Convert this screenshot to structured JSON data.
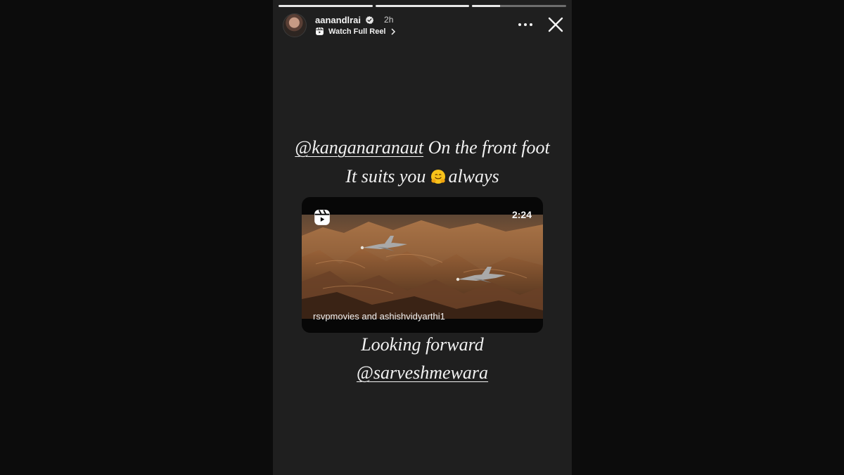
{
  "story": {
    "progress": [
      1.0,
      1.0,
      0.3
    ],
    "user": {
      "username": "aanandlrai",
      "time": "2h",
      "subline": "Watch Full Reel"
    },
    "icons": [
      "avatar",
      "verified-badge-icon",
      "reel-icon",
      "chevron-right-icon",
      "more-options-icon",
      "close-icon",
      "hugging-face-emoji"
    ]
  },
  "caption": {
    "line1_mention": "@kanganaranaut",
    "line1_rest": " On the front foot",
    "line2_before": "It suits you",
    "line2_after": "always",
    "line3": "Looking forward",
    "line4_mention": "@sarveshmewara"
  },
  "reel": {
    "duration": "2:24",
    "credit": "rsvpmovies and ashishvidyarthi1"
  },
  "colors": {
    "background": "#0c0c0c",
    "story_bg": "#1f1f1f",
    "text": "#f2f2f2"
  }
}
